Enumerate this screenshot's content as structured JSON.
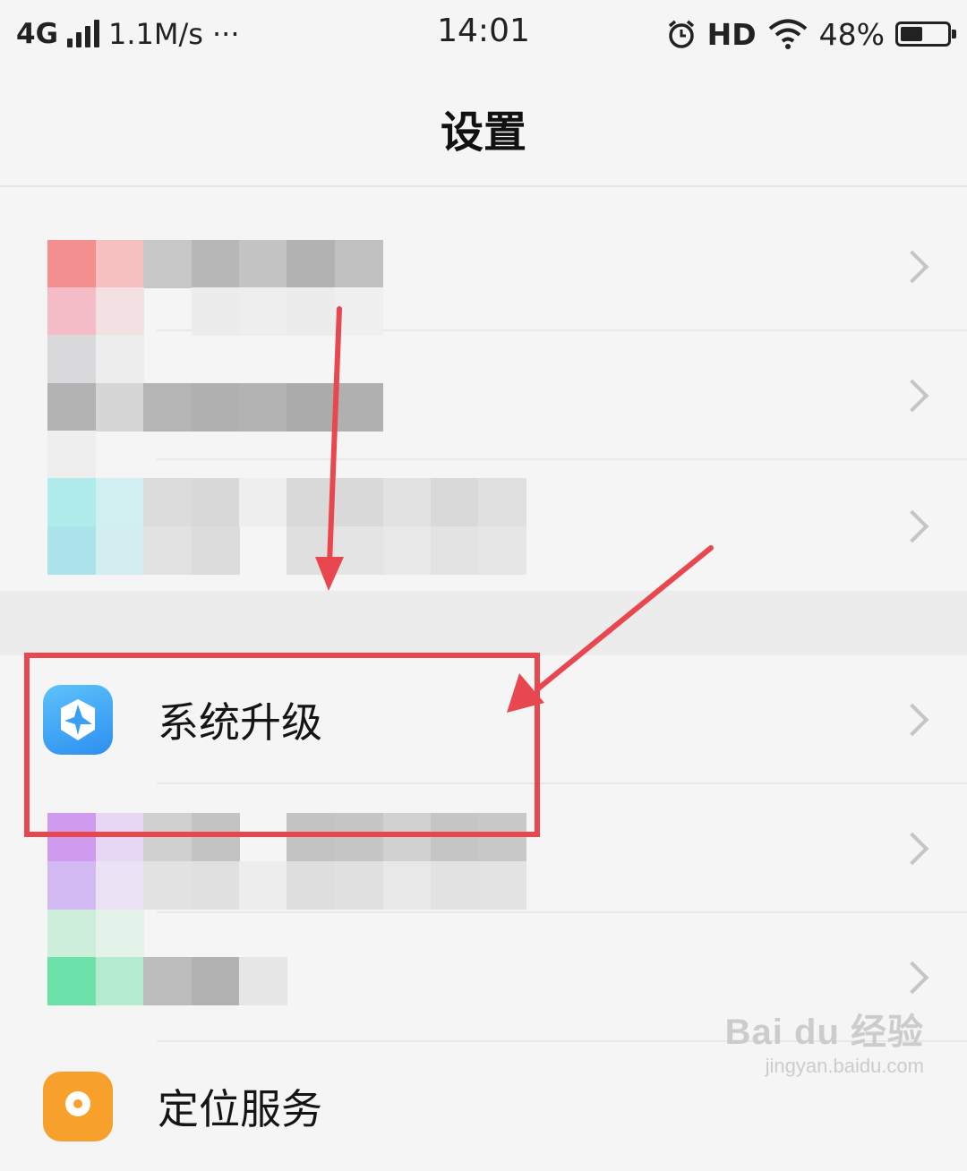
{
  "status_bar": {
    "network": "4G",
    "speed": "1.1M/s",
    "more": "···",
    "time": "14:01",
    "hd": "HD",
    "battery_percent": "48%",
    "battery_level": 0.48
  },
  "header": {
    "title": "设置"
  },
  "list": {
    "system_update": {
      "label": "系统升级",
      "icon": "system-update-icon",
      "icon_color": "#3aa7f3"
    },
    "location_partial": {
      "label": "定位服务",
      "icon_color": "#f7a12c"
    }
  },
  "watermark": {
    "logo": "Bai du 经验",
    "url": "jingyan.baidu.com"
  },
  "colors": {
    "annotation": "#e8474f",
    "chevron": "#c5c5c5",
    "background": "#f5f5f5"
  }
}
